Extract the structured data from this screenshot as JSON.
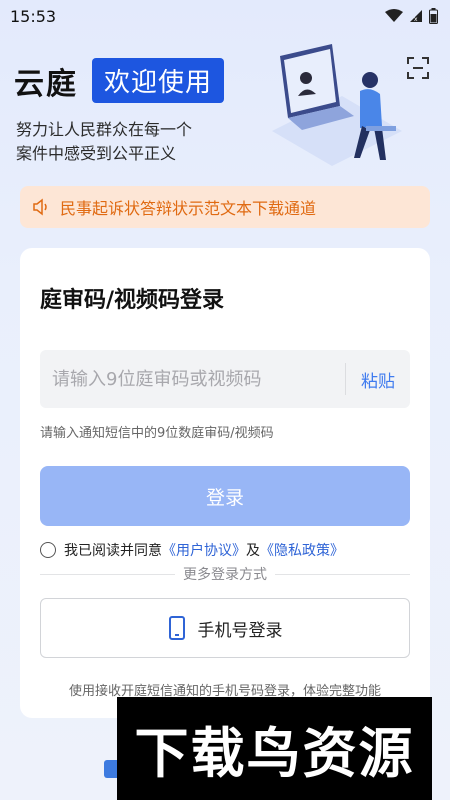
{
  "status_bar": {
    "time": "15:53"
  },
  "header": {
    "app_name": "云庭",
    "welcome": "欢迎使用",
    "slogan_line1": "努力让人民群众在每一个",
    "slogan_line2": "案件中感受到公平正义"
  },
  "notice": {
    "text": "民事起诉状答辩状示范文本下载通道"
  },
  "login_card": {
    "title": "庭审码/视频码登录",
    "input_placeholder": "请输入9位庭审码或视频码",
    "input_value": "",
    "paste_label": "粘贴",
    "hint": "请输入通知短信中的9位数庭审码/视频码",
    "login_label": "登录",
    "agreement_prefix": "我已阅读并同意",
    "user_agreement": "《用户协议》",
    "agreement_and": "及",
    "privacy_policy": "《隐私政策》",
    "more_login": "更多登录方式",
    "phone_login_label": "手机号登录",
    "phone_hint": "使用接收开庭短信通知的手机号码登录，体验完整功能"
  },
  "watermark": {
    "text": "下载鸟资源"
  },
  "colors": {
    "brand_blue": "#1d56e0",
    "login_button": "#98b6f6",
    "notice_bg": "#fde6d6",
    "notice_text": "#e06a12",
    "link": "#2f64d6"
  }
}
